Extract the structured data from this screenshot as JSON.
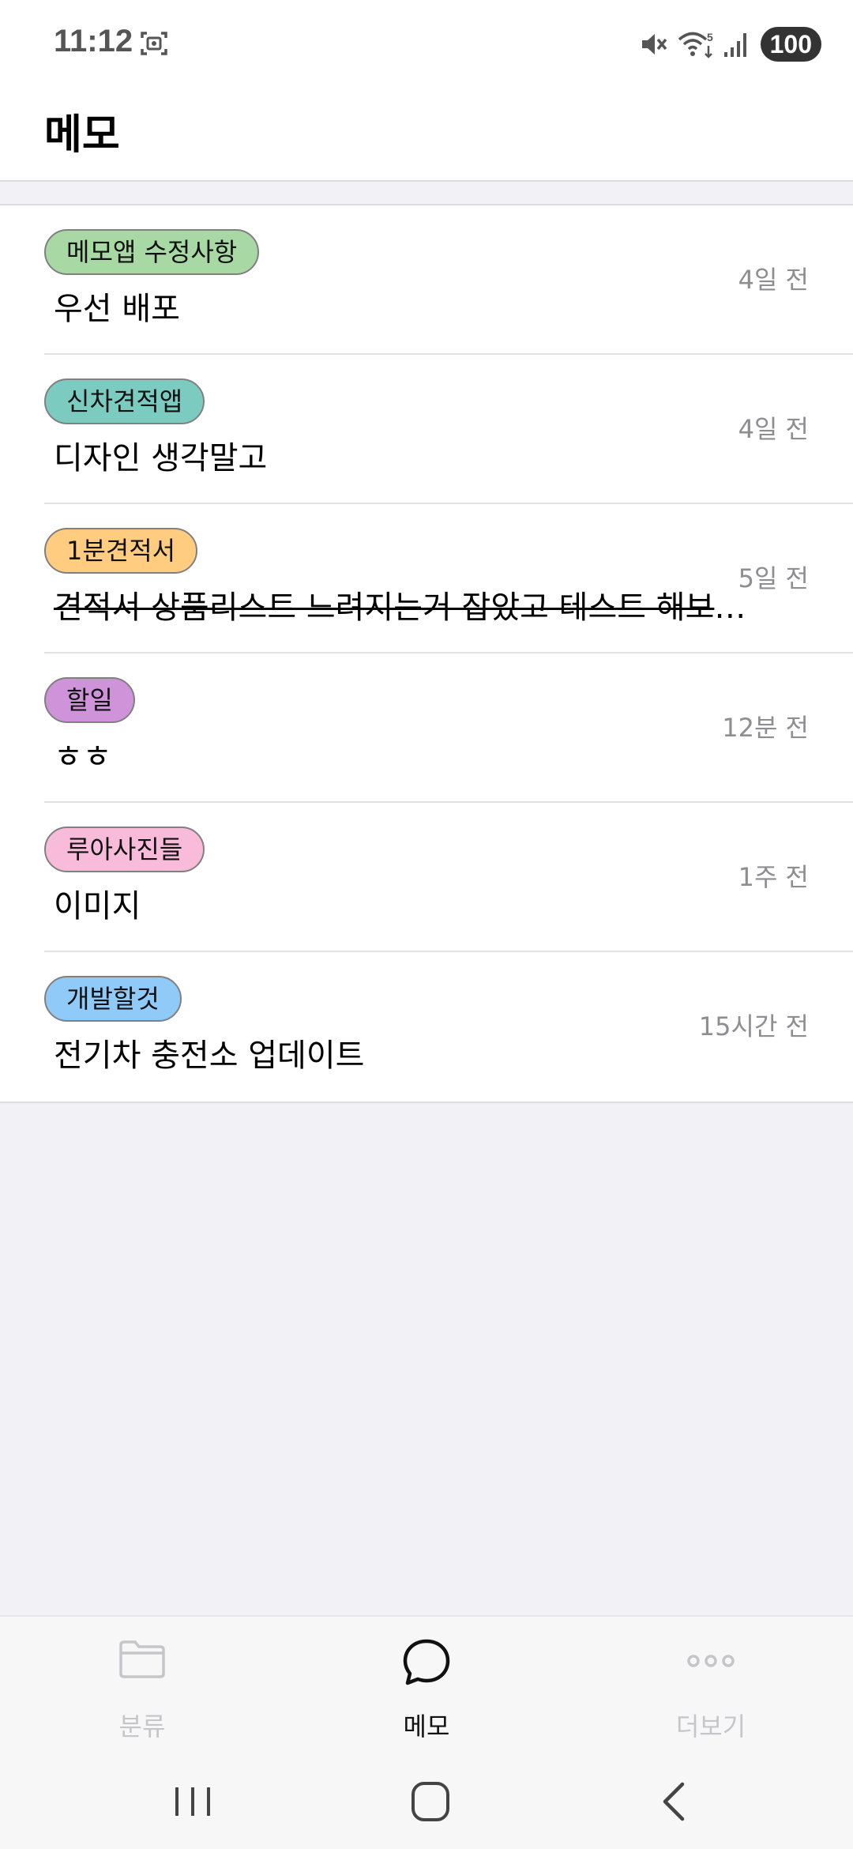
{
  "status_bar": {
    "time": "11:12",
    "battery": "100",
    "icons": [
      "screenshot-icon",
      "mute-icon",
      "wifi-icon",
      "signal-icon",
      "battery-icon"
    ]
  },
  "header": {
    "title": "메모"
  },
  "memos": [
    {
      "tag": "메모앱 수정사항",
      "tag_color": "#a8d8a4",
      "title": "우선 배포",
      "time": "4일 전",
      "struck": false
    },
    {
      "tag": "신차견적앱",
      "tag_color": "#7ccbc1",
      "title": "디자인 생각말고",
      "time": "4일 전",
      "struck": false
    },
    {
      "tag": "1분견적서",
      "tag_color": "#ffcc80",
      "title": "견적서 상품리스트 느려지는거 잡았고 테스트 해보고 배포",
      "time": "5일 전",
      "struck": true
    },
    {
      "tag": "할일",
      "tag_color": "#ce93d8",
      "title": "ㅎㅎ",
      "time": "12분 전",
      "struck": false
    },
    {
      "tag": "루아사진들",
      "tag_color": "#f8bbd9",
      "title": "이미지",
      "time": "1주 전",
      "struck": false
    },
    {
      "tag": "개발할것",
      "tag_color": "#90caf9",
      "title": "전기차 충전소 업데이트",
      "time": "15시간 전",
      "struck": false
    }
  ],
  "bottom_nav": {
    "items": [
      {
        "label": "분류",
        "icon": "folder-icon",
        "active": false
      },
      {
        "label": "메모",
        "icon": "chat-bubble-icon",
        "active": true
      },
      {
        "label": "더보기",
        "icon": "more-dots-icon",
        "active": false
      }
    ]
  },
  "system_nav": {
    "icons": [
      "recent-apps-icon",
      "home-icon",
      "back-icon"
    ]
  }
}
